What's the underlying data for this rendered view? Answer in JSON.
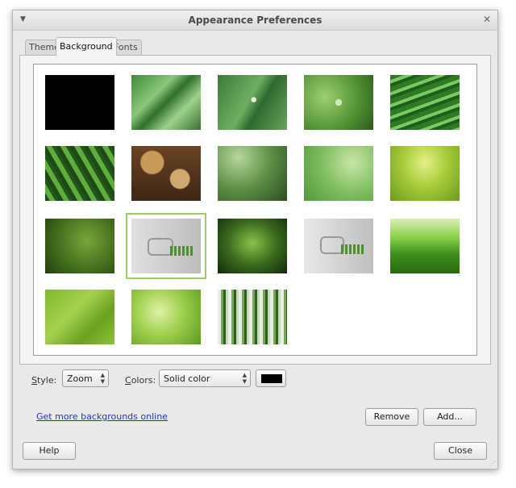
{
  "window": {
    "title": "Appearance Preferences"
  },
  "tabs": [
    {
      "label": "Theme"
    },
    {
      "label": "Background"
    },
    {
      "label": "Fonts"
    }
  ],
  "backgrounds": [
    {
      "name": "black"
    },
    {
      "name": "green-leaf-drops"
    },
    {
      "name": "leaf-water-drop"
    },
    {
      "name": "twig-drop"
    },
    {
      "name": "grass-blades"
    },
    {
      "name": "fern"
    },
    {
      "name": "pebbles"
    },
    {
      "name": "green-swirl"
    },
    {
      "name": "green-bubbles"
    },
    {
      "name": "lime-gradient"
    },
    {
      "name": "dark-green-gradient"
    },
    {
      "name": "linux-mint-logo",
      "selected": true
    },
    {
      "name": "dark-green-glow"
    },
    {
      "name": "linux-mint-logo-2"
    },
    {
      "name": "grass-field"
    },
    {
      "name": "lime-geometric"
    },
    {
      "name": "green-bokeh"
    },
    {
      "name": "green-stripes"
    }
  ],
  "style": {
    "label": "Style:",
    "value": "Zoom"
  },
  "colors": {
    "label": "Colors:",
    "value": "Solid color",
    "swatch": "#000000"
  },
  "links": {
    "more_backgrounds": "Get more backgrounds online"
  },
  "buttons": {
    "remove": "Remove",
    "add": "Add...",
    "help": "Help",
    "close": "Close"
  },
  "icons": {
    "menu": "chevron-down-icon",
    "close": "close-icon"
  }
}
